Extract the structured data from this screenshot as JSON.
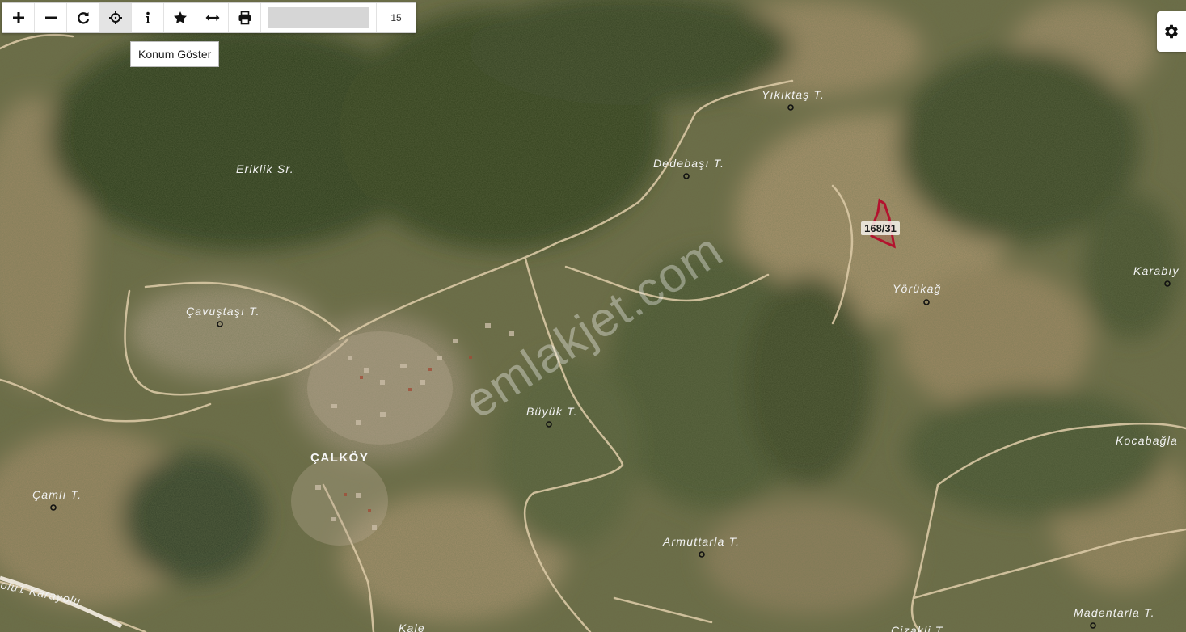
{
  "toolbar": {
    "buttons": [
      {
        "name": "zoom-in",
        "icon": "plus-icon"
      },
      {
        "name": "zoom-out",
        "icon": "minus-icon"
      },
      {
        "name": "refresh",
        "icon": "refresh-icon"
      },
      {
        "name": "locate",
        "icon": "crosshair-icon"
      },
      {
        "name": "info",
        "icon": "info-icon"
      },
      {
        "name": "favorite",
        "icon": "star-icon"
      },
      {
        "name": "measure",
        "icon": "arrows-horizontal-icon"
      },
      {
        "name": "print",
        "icon": "printer-icon"
      }
    ],
    "search_value": "",
    "zoom_level": "15"
  },
  "tooltip": {
    "text": "Konum Göster"
  },
  "settings": {
    "icon": "gear-icon"
  },
  "parcel": {
    "label": "168/31",
    "outline_color": "#b3122e"
  },
  "places": {
    "yikiktas": "Yıkıktaş T.",
    "dedebasi": "Dedebaşı T.",
    "eriklik": "Eriklik Sr.",
    "cavustasi": "Çavuştaşı T.",
    "yorukag": "Yörükağ",
    "karabiy": "Karabıy",
    "buyuk": "Büyük T.",
    "calkoy": "ÇALKÖY",
    "kocabagla": "Kocabağla",
    "camli": "Çamlı T.",
    "armuttarla": "Armuttarla T.",
    "madentarla": "Madentarla T.",
    "karayolu": "olu1 Karayolu",
    "kale": "Kale",
    "cizakli": "Çizakli T."
  },
  "watermark": "emlakjet.com",
  "colors": {
    "forest": "#3d4a26",
    "field": "#a89470",
    "road": "#d8c7a6",
    "label": "#f2f2f2"
  }
}
